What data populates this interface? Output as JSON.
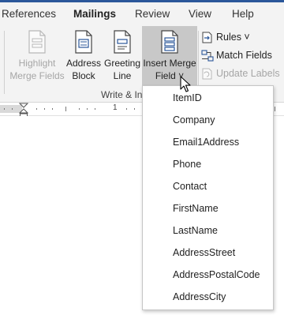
{
  "tabs": [
    "References",
    "Mailings",
    "Review",
    "View",
    "Help"
  ],
  "active_tab": "Mailings",
  "ribbon": {
    "buttons": [
      {
        "line1": "Highlight",
        "line2": "Merge Fields",
        "state": "disabled"
      },
      {
        "line1": "Address",
        "line2": "Block",
        "state": "enabled"
      },
      {
        "line1": "Greeting",
        "line2": "Line",
        "state": "enabled"
      },
      {
        "line1": "Insert Merge",
        "line2": "Field ˅",
        "state": "pressed"
      }
    ],
    "small_buttons": [
      {
        "label": "Rules ˅",
        "icon": "rules-icon",
        "state": "enabled"
      },
      {
        "label": "Match Fields",
        "icon": "match-fields-icon",
        "state": "enabled"
      },
      {
        "label": "Update Labels",
        "icon": "update-labels-icon",
        "state": "disabled"
      }
    ],
    "group_label": "Write & In"
  },
  "ruler": {
    "number": "1"
  },
  "merge_fields": [
    "ItemID",
    "Company",
    "Email1Address",
    "Phone",
    "Contact",
    "FirstName",
    "LastName",
    "AddressStreet",
    "AddressPostalCode",
    "AddressCity"
  ],
  "colors": {
    "accent": "#2b579a",
    "ribbon_bg": "#f3f3f3",
    "pressed_bg": "#c8c8c8",
    "disabled_text": "#a6a6a6"
  }
}
